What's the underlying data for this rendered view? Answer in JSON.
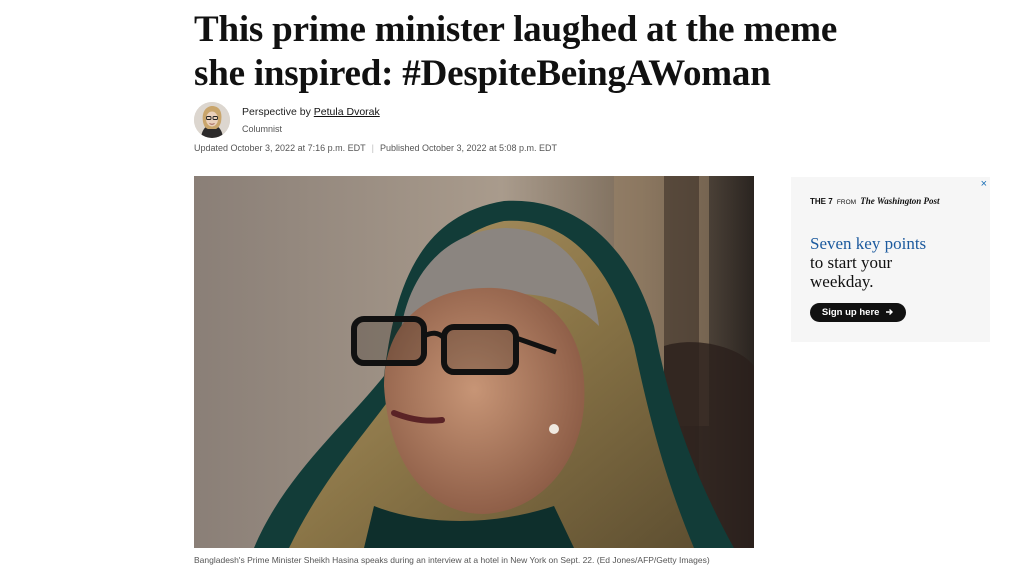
{
  "article": {
    "headline": "This prime minister laughed at the meme she inspired: #DespiteBeingAWoman",
    "byline": {
      "prefix": "Perspective by",
      "author": "Petula Dvorak",
      "role": "Columnist"
    },
    "dates": {
      "updated": "Updated October 3, 2022 at 7:16 p.m. EDT",
      "published": "Published October 3, 2022 at 5:08 p.m. EDT"
    },
    "photo_caption": "Bangladesh's Prime Minister Sheikh Hasina speaks during an interview at a hotel in New York on Sept. 22. (Ed Jones/AFP/Getty Images)"
  },
  "ad": {
    "close_glyph": "×",
    "brand": "THE 7",
    "brand_from": "FROM",
    "brand_paper": "The Washington Post",
    "headline_blue": "Seven key points",
    "headline_black_1": "to start your",
    "headline_black_2": "weekday.",
    "button_label": "Sign up here",
    "button_icon": "arrow-right-icon"
  },
  "colors": {
    "ad_accent": "#1c5a9e",
    "ad_background": "#f6f6f6",
    "button_background": "#111111"
  }
}
